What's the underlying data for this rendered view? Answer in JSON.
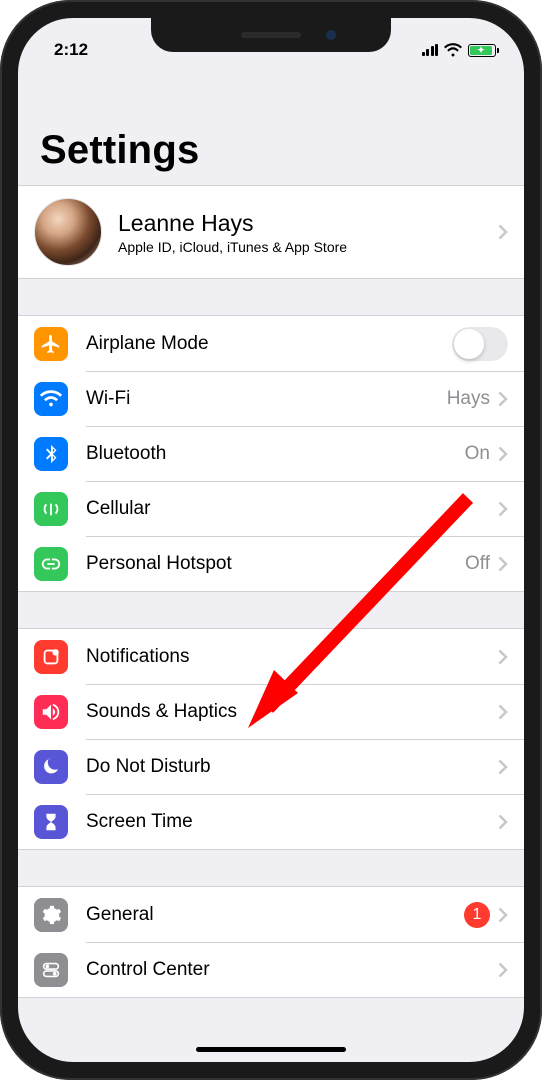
{
  "status": {
    "time": "2:12"
  },
  "page": {
    "title": "Settings"
  },
  "profile": {
    "name": "Leanne Hays",
    "subtitle": "Apple ID, iCloud, iTunes & App Store"
  },
  "groups": [
    {
      "rows": [
        {
          "id": "airplane",
          "label": "Airplane Mode",
          "icon": "airplane",
          "color": "orange",
          "type": "toggle",
          "toggled": false
        },
        {
          "id": "wifi",
          "label": "Wi-Fi",
          "icon": "wifi",
          "color": "blue",
          "type": "link",
          "value": "Hays"
        },
        {
          "id": "bluetooth",
          "label": "Bluetooth",
          "icon": "bluetooth",
          "color": "blue",
          "type": "link",
          "value": "On"
        },
        {
          "id": "cellular",
          "label": "Cellular",
          "icon": "antenna",
          "color": "green",
          "type": "link"
        },
        {
          "id": "hotspot",
          "label": "Personal Hotspot",
          "icon": "link",
          "color": "green",
          "type": "link",
          "value": "Off"
        }
      ]
    },
    {
      "rows": [
        {
          "id": "notifications",
          "label": "Notifications",
          "icon": "bell-badge",
          "color": "red",
          "type": "link"
        },
        {
          "id": "sounds",
          "label": "Sounds & Haptics",
          "icon": "speaker",
          "color": "pink",
          "type": "link"
        },
        {
          "id": "dnd",
          "label": "Do Not Disturb",
          "icon": "moon",
          "color": "purple",
          "type": "link"
        },
        {
          "id": "screentime",
          "label": "Screen Time",
          "icon": "hourglass",
          "color": "purple",
          "type": "link"
        }
      ]
    },
    {
      "rows": [
        {
          "id": "general",
          "label": "General",
          "icon": "gear",
          "color": "gray",
          "type": "link",
          "badge": "1"
        },
        {
          "id": "controlcenter",
          "label": "Control Center",
          "icon": "switches",
          "color": "gray",
          "type": "link"
        }
      ]
    }
  ],
  "annotation": {
    "target_row": "notifications"
  }
}
